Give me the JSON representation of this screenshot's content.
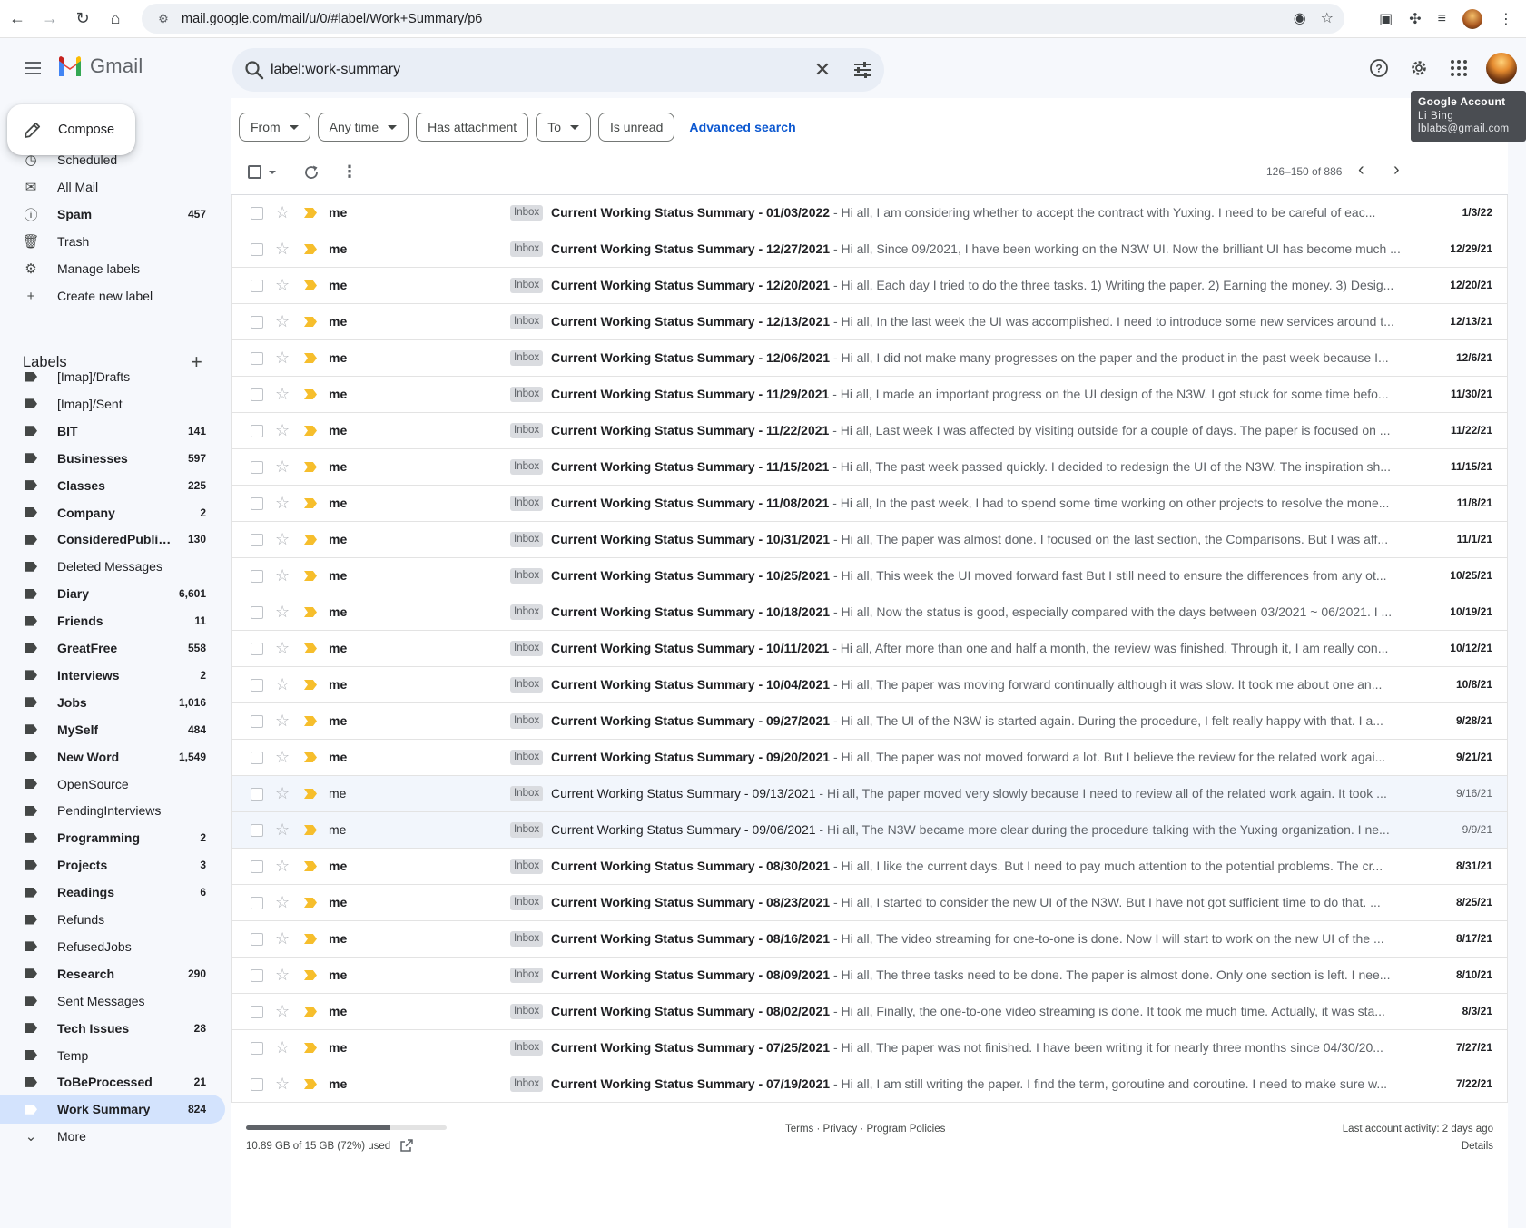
{
  "browser": {
    "url": "mail.google.com/mail/u/0/#label/Work+Summary/p6"
  },
  "app": {
    "name": "Gmail"
  },
  "search": {
    "query": "label:work-summary"
  },
  "account_tooltip": {
    "title": "Google Account",
    "name": "Li Bing",
    "email": "lblabs@gmail.com"
  },
  "sidebar": {
    "compose_label": "Compose",
    "system_items": [
      {
        "label": "Scheduled",
        "icon": "schedule-send-icon",
        "count": "",
        "bold": false
      },
      {
        "label": "All Mail",
        "icon": "all-mail-icon",
        "count": "",
        "bold": false
      },
      {
        "label": "Spam",
        "icon": "spam-icon",
        "count": "457",
        "bold": true
      },
      {
        "label": "Trash",
        "icon": "trash-icon",
        "count": "",
        "bold": false
      },
      {
        "label": "Manage labels",
        "icon": "gear-icon",
        "count": "",
        "bold": false
      },
      {
        "label": "Create new label",
        "icon": "plus-icon",
        "count": "",
        "bold": false
      }
    ],
    "labels_heading": "Labels",
    "labels": [
      {
        "label": "[Imap]/Drafts",
        "count": "",
        "bold": false
      },
      {
        "label": "[Imap]/Sent",
        "count": "",
        "bold": false
      },
      {
        "label": "BIT",
        "count": "141",
        "bold": true
      },
      {
        "label": "Businesses",
        "count": "597",
        "bold": true
      },
      {
        "label": "Classes",
        "count": "225",
        "bold": true
      },
      {
        "label": "Company",
        "count": "2",
        "bold": true
      },
      {
        "label": "ConsideredPublications",
        "count": "130",
        "bold": true
      },
      {
        "label": "Deleted Messages",
        "count": "",
        "bold": false
      },
      {
        "label": "Diary",
        "count": "6,601",
        "bold": true
      },
      {
        "label": "Friends",
        "count": "11",
        "bold": true
      },
      {
        "label": "GreatFree",
        "count": "558",
        "bold": true
      },
      {
        "label": "Interviews",
        "count": "2",
        "bold": true
      },
      {
        "label": "Jobs",
        "count": "1,016",
        "bold": true
      },
      {
        "label": "MySelf",
        "count": "484",
        "bold": true
      },
      {
        "label": "New Word",
        "count": "1,549",
        "bold": true
      },
      {
        "label": "OpenSource",
        "count": "",
        "bold": false
      },
      {
        "label": "PendingInterviews",
        "count": "",
        "bold": false
      },
      {
        "label": "Programming",
        "count": "2",
        "bold": true
      },
      {
        "label": "Projects",
        "count": "3",
        "bold": true
      },
      {
        "label": "Readings",
        "count": "6",
        "bold": true
      },
      {
        "label": "Refunds",
        "count": "",
        "bold": false
      },
      {
        "label": "RefusedJobs",
        "count": "",
        "bold": false
      },
      {
        "label": "Research",
        "count": "290",
        "bold": true
      },
      {
        "label": "Sent Messages",
        "count": "",
        "bold": false
      },
      {
        "label": "Tech Issues",
        "count": "28",
        "bold": true
      },
      {
        "label": "Temp",
        "count": "",
        "bold": false
      },
      {
        "label": "ToBeProcessed",
        "count": "21",
        "bold": true
      },
      {
        "label": "Work Summary",
        "count": "824",
        "bold": true,
        "active": true
      }
    ],
    "more_label": "More"
  },
  "filters": {
    "from": "From",
    "any_time": "Any time",
    "has_attachment": "Has attachment",
    "to": "To",
    "is_unread": "Is unread",
    "advanced_search": "Advanced search"
  },
  "toolbar": {
    "range": "126–150 of 886"
  },
  "badge_text": "Inbox",
  "emails": [
    {
      "sender": "me",
      "subject": "Current Working Status Summary - 01/03/2022",
      "snippet": "Hi all, I am considering whether to accept the contract with Yuxing. I need to be careful of eac...",
      "date": "1/3/22",
      "read": false
    },
    {
      "sender": "me",
      "subject": "Current Working Status Summary - 12/27/2021",
      "snippet": "Hi all, Since 09/2021, I have been working on the N3W UI. Now the brilliant UI has become much ...",
      "date": "12/29/21",
      "read": false
    },
    {
      "sender": "me",
      "subject": "Current Working Status Summary - 12/20/2021",
      "snippet": "Hi all, Each day I tried to do the three tasks. 1) Writing the paper. 2) Earning the money. 3) Desig...",
      "date": "12/20/21",
      "read": false
    },
    {
      "sender": "me",
      "subject": "Current Working Status Summary - 12/13/2021",
      "snippet": "Hi all, In the last week the UI was accomplished. I need to introduce some new services around t...",
      "date": "12/13/21",
      "read": false
    },
    {
      "sender": "me",
      "subject": "Current Working Status Summary - 12/06/2021",
      "snippet": "Hi all, I did not make many progresses on the paper and the product in the past week because I...",
      "date": "12/6/21",
      "read": false
    },
    {
      "sender": "me",
      "subject": "Current Working Status Summary - 11/29/2021",
      "snippet": "Hi all, I made an important progress on the UI design of the N3W. I got stuck for some time befo...",
      "date": "11/30/21",
      "read": false
    },
    {
      "sender": "me",
      "subject": "Current Working Status Summary - 11/22/2021",
      "snippet": "Hi all, Last week I was affected by visiting outside for a couple of days. The paper is focused on ...",
      "date": "11/22/21",
      "read": false
    },
    {
      "sender": "me",
      "subject": "Current Working Status Summary - 11/15/2021",
      "snippet": "Hi all, The past week passed quickly. I decided to redesign the UI of the N3W. The inspiration sh...",
      "date": "11/15/21",
      "read": false
    },
    {
      "sender": "me",
      "subject": "Current Working Status Summary - 11/08/2021",
      "snippet": "Hi all, In the past week, I had to spend some time working on other projects to resolve the mone...",
      "date": "11/8/21",
      "read": false
    },
    {
      "sender": "me",
      "subject": "Current Working Status Summary - 10/31/2021",
      "snippet": "Hi all, The paper was almost done. I focused on the last section, the Comparisons. But I was aff...",
      "date": "11/1/21",
      "read": false
    },
    {
      "sender": "me",
      "subject": "Current Working Status Summary - 10/25/2021",
      "snippet": "Hi all, This week the UI moved forward fast But I still need to ensure the differences from any ot...",
      "date": "10/25/21",
      "read": false
    },
    {
      "sender": "me",
      "subject": "Current Working Status Summary - 10/18/2021",
      "snippet": "Hi all, Now the status is good, especially compared with the days between 03/2021 ~ 06/2021. I ...",
      "date": "10/19/21",
      "read": false
    },
    {
      "sender": "me",
      "subject": "Current Working Status Summary - 10/11/2021",
      "snippet": "Hi all, After more than one and half a month, the review was finished. Through it, I am really con...",
      "date": "10/12/21",
      "read": false
    },
    {
      "sender": "me",
      "subject": "Current Working Status Summary - 10/04/2021",
      "snippet": "Hi all, The paper was moving forward continually although it was slow. It took me about one an...",
      "date": "10/8/21",
      "read": false
    },
    {
      "sender": "me",
      "subject": "Current Working Status Summary - 09/27/2021",
      "snippet": "Hi all, The UI of the N3W is started again. During the procedure, I felt really happy with that. I a...",
      "date": "9/28/21",
      "read": false
    },
    {
      "sender": "me",
      "subject": "Current Working Status Summary - 09/20/2021",
      "snippet": "Hi all, The paper was not moved forward a lot. But I believe the review for the related work agai...",
      "date": "9/21/21",
      "read": false
    },
    {
      "sender": "me",
      "subject": "Current Working Status Summary - 09/13/2021",
      "snippet": "Hi all, The paper moved very slowly because I need to review all of the related work again. It took ...",
      "date": "9/16/21",
      "read": true
    },
    {
      "sender": "me",
      "subject": "Current Working Status Summary - 09/06/2021",
      "snippet": "Hi all, The N3W became more clear during the procedure talking with the Yuxing organization. I ne...",
      "date": "9/9/21",
      "read": true
    },
    {
      "sender": "me",
      "subject": "Current Working Status Summary - 08/30/2021",
      "snippet": "Hi all, I like the current days. But I need to pay much attention to the potential problems. The cr...",
      "date": "8/31/21",
      "read": false
    },
    {
      "sender": "me",
      "subject": "Current Working Status Summary - 08/23/2021",
      "snippet": "Hi all, I started to consider the new UI of the N3W. But I have not got sufficient time to do that. ...",
      "date": "8/25/21",
      "read": false
    },
    {
      "sender": "me",
      "subject": "Current Working Status Summary - 08/16/2021",
      "snippet": "Hi all, The video streaming for one-to-one is done. Now I will start to work on the new UI of the ...",
      "date": "8/17/21",
      "read": false
    },
    {
      "sender": "me",
      "subject": "Current Working Status Summary - 08/09/2021",
      "snippet": "Hi all, The three tasks need to be done. The paper is almost done. Only one section is left. I nee...",
      "date": "8/10/21",
      "read": false
    },
    {
      "sender": "me",
      "subject": "Current Working Status Summary - 08/02/2021",
      "snippet": "Hi all, Finally, the one-to-one video streaming is done. It took me much time. Actually, it was sta...",
      "date": "8/3/21",
      "read": false
    },
    {
      "sender": "me",
      "subject": "Current Working Status Summary - 07/25/2021",
      "snippet": "Hi all, The paper was not finished. I have been writing it for nearly three months since 04/30/20...",
      "date": "7/27/21",
      "read": false
    },
    {
      "sender": "me",
      "subject": "Current Working Status Summary - 07/19/2021",
      "snippet": "Hi all, I am still writing the paper. I find the term, goroutine and coroutine. I need to make sure w...",
      "date": "7/22/21",
      "read": false
    }
  ],
  "footer": {
    "storage_text": "10.89 GB of 15 GB (72%) used",
    "storage_fraction": 0.72,
    "links": "Terms · Privacy · Program Policies",
    "activity": "Last account activity: 2 days ago",
    "details": "Details"
  },
  "colors": {
    "accent_blue": "#0b57d0",
    "important_marker": "#f6be2c",
    "sidebar_bg": "#f6f8fc",
    "active_label_bg": "#d3e3fd"
  }
}
